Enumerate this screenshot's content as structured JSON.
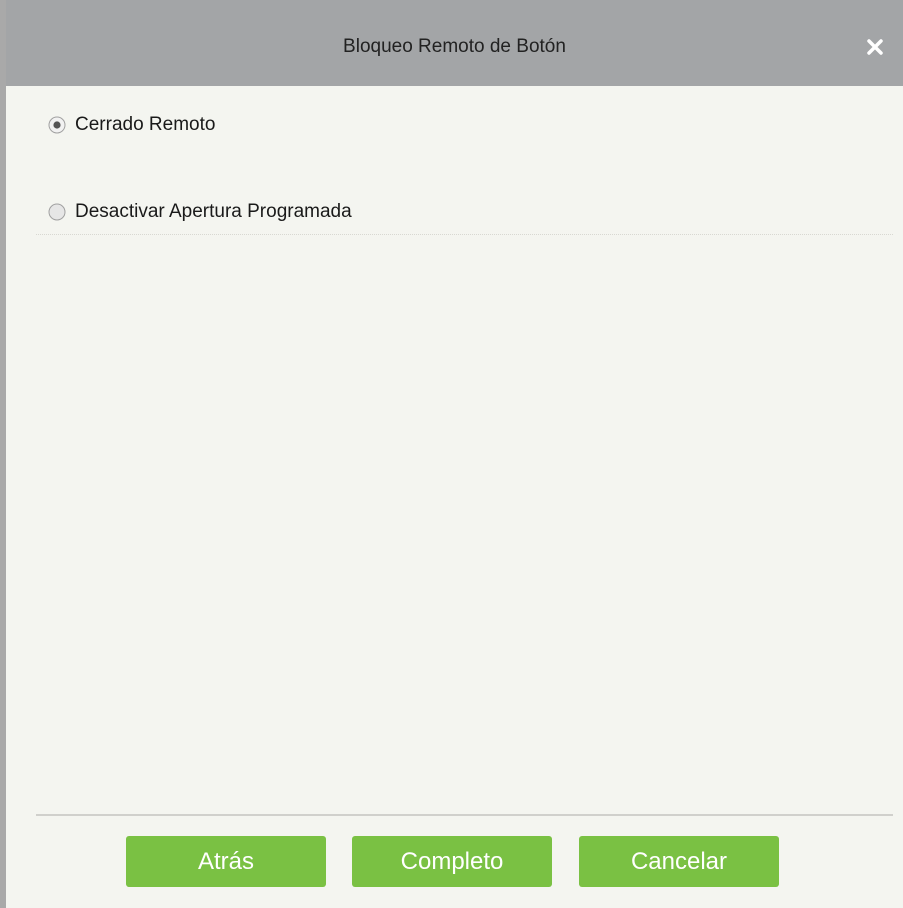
{
  "dialog": {
    "title": "Bloqueo Remoto de Botón",
    "close_icon": "close-icon"
  },
  "options": [
    {
      "label": "Cerrado Remoto",
      "selected": true
    },
    {
      "label": "Desactivar Apertura Programada",
      "selected": false
    }
  ],
  "buttons": {
    "back_label": "Atrás",
    "complete_label": "Completo",
    "cancel_label": "Cancelar"
  },
  "colors": {
    "titlebar": "#a3a5a7",
    "background": "#f4f5f0",
    "button_green": "#7ac143",
    "button_text": "#ffffff"
  }
}
